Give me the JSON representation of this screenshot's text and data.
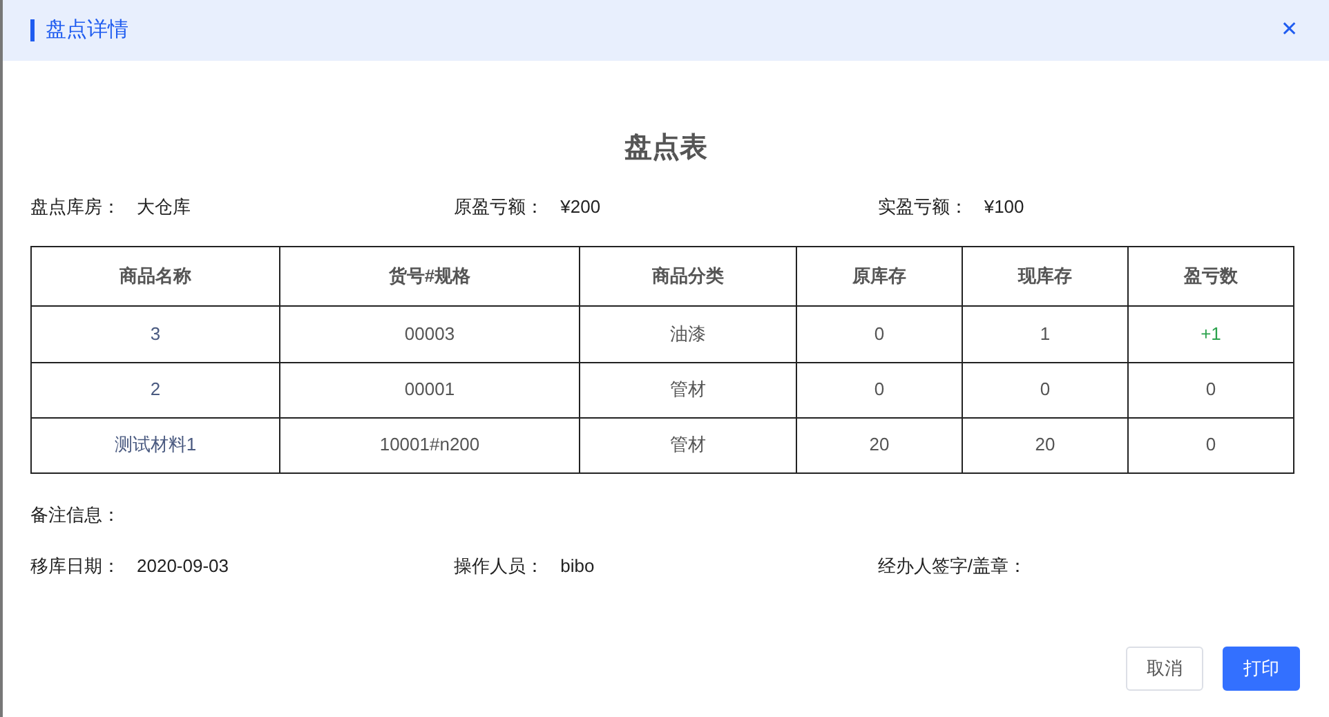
{
  "dialog": {
    "title": "盘点详情",
    "close": "✕"
  },
  "sheet_title": "盘点表",
  "summary": [
    {
      "label": "盘点库房：",
      "value": "大仓库"
    },
    {
      "label": "原盈亏额：",
      "value": "¥200"
    },
    {
      "label": "实盈亏额：",
      "value": "¥100"
    }
  ],
  "table": {
    "columns": [
      "商品名称",
      "货号#规格",
      "商品分类",
      "原库存",
      "现库存",
      "盈亏数"
    ],
    "rows": [
      {
        "cells": [
          "3",
          "00003",
          "油漆",
          "0",
          "1",
          "+1"
        ],
        "color": "#2ba24c"
      },
      {
        "cells": [
          "2",
          "00001",
          "管材",
          "0",
          "0",
          "0"
        ],
        "color": "#555555"
      },
      {
        "cells": [
          "测试材料1",
          "10001#n200",
          "管材",
          "20",
          "20",
          "0"
        ],
        "color": "#555555"
      }
    ]
  },
  "remark": {
    "label": "备注信息："
  },
  "footer_fields": [
    {
      "label": "移库日期：",
      "value": "2020-09-03"
    },
    {
      "label": "操作人员：",
      "value": "bibo"
    },
    {
      "label": "经办人签字/盖章："
    }
  ],
  "buttons": [
    {
      "label": "取消",
      "kind": "secondary"
    },
    {
      "label": "打印",
      "kind": "primary"
    }
  ]
}
